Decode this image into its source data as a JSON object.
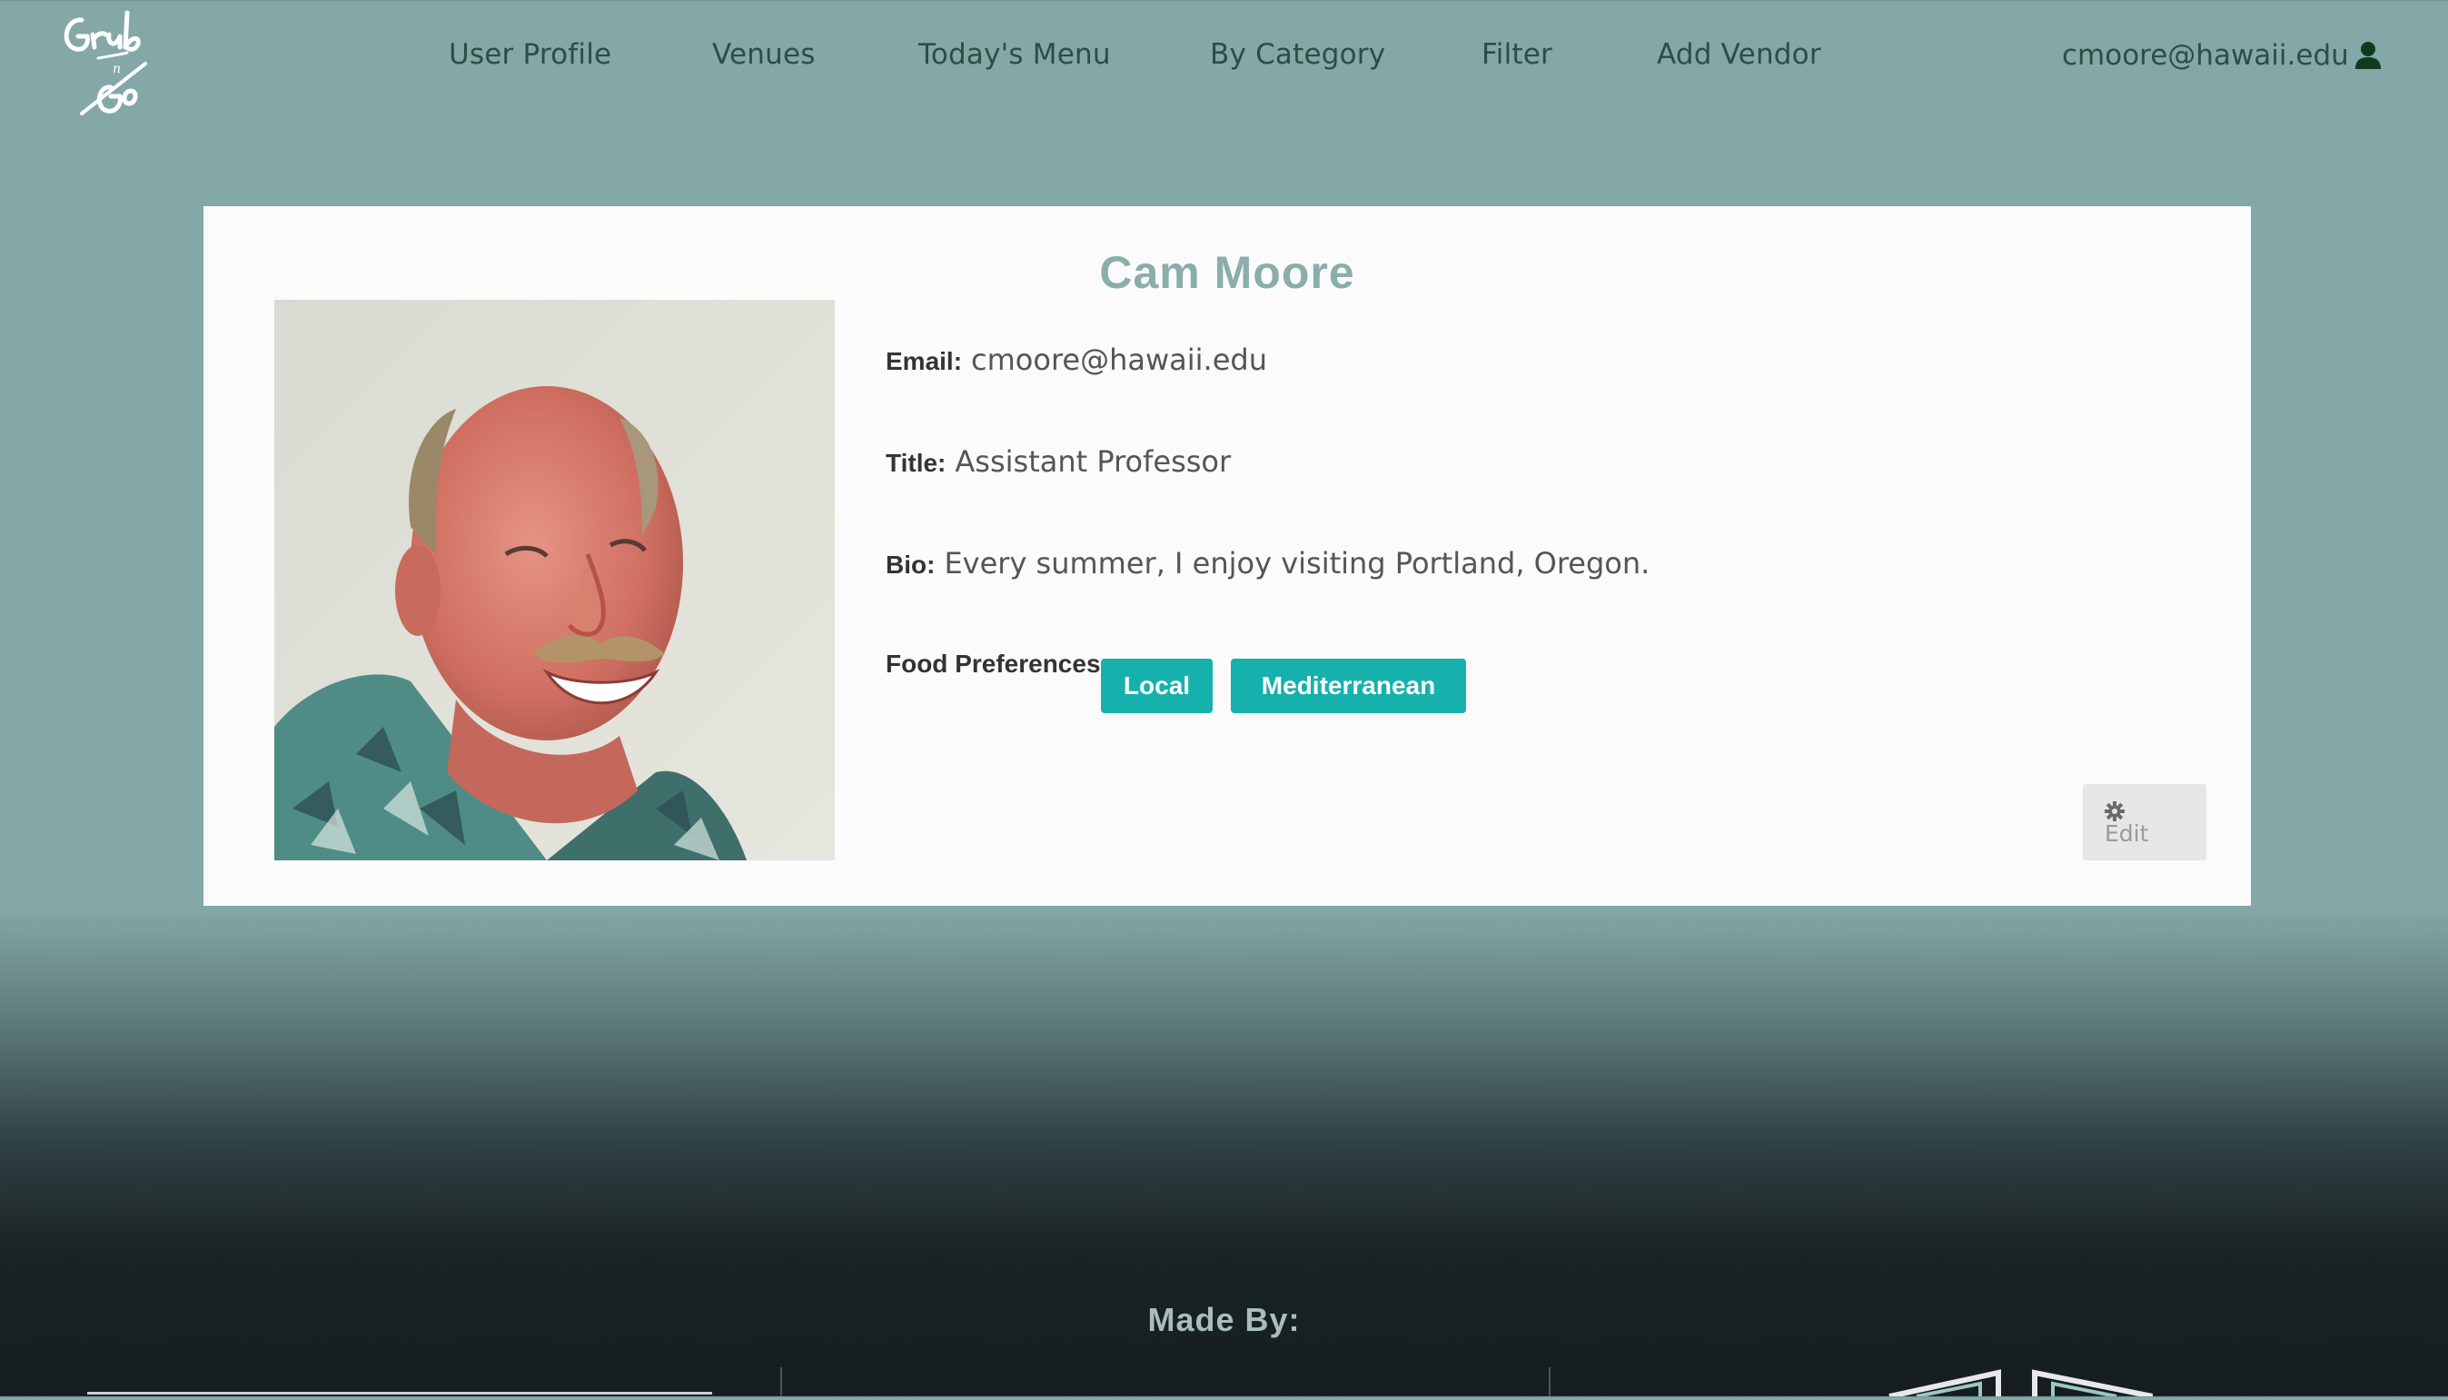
{
  "navbar": {
    "logo_text": "Grub n Go",
    "items": [
      {
        "label": "User Profile"
      },
      {
        "label": "Venues"
      },
      {
        "label": "Today's Menu"
      },
      {
        "label": "By Category"
      },
      {
        "label": "Filter"
      },
      {
        "label": "Add Vendor"
      }
    ],
    "user_email": "cmoore@hawaii.edu",
    "user_icon": "user-icon"
  },
  "profile": {
    "name": "Cam Moore",
    "email_label": "Email:",
    "email": "cmoore@hawaii.edu",
    "title_label": "Title:",
    "title": "Assistant Professor",
    "bio_label": "Bio:",
    "bio": "Every summer, I enjoy visiting Portland, Oregon.",
    "preferences_label": "Food Preferences:",
    "preferences": [
      "Local",
      "Mediterranean"
    ],
    "edit_label": "Edit",
    "edit_icon": "gear-icon"
  },
  "footer": {
    "made_by": "Made By:"
  },
  "colors": {
    "background": "#83a8a7",
    "nav_text": "#2b4f45",
    "name_text": "#8aaeaa",
    "badge": "#16b1ad",
    "footer_dark": "#151d1f"
  }
}
